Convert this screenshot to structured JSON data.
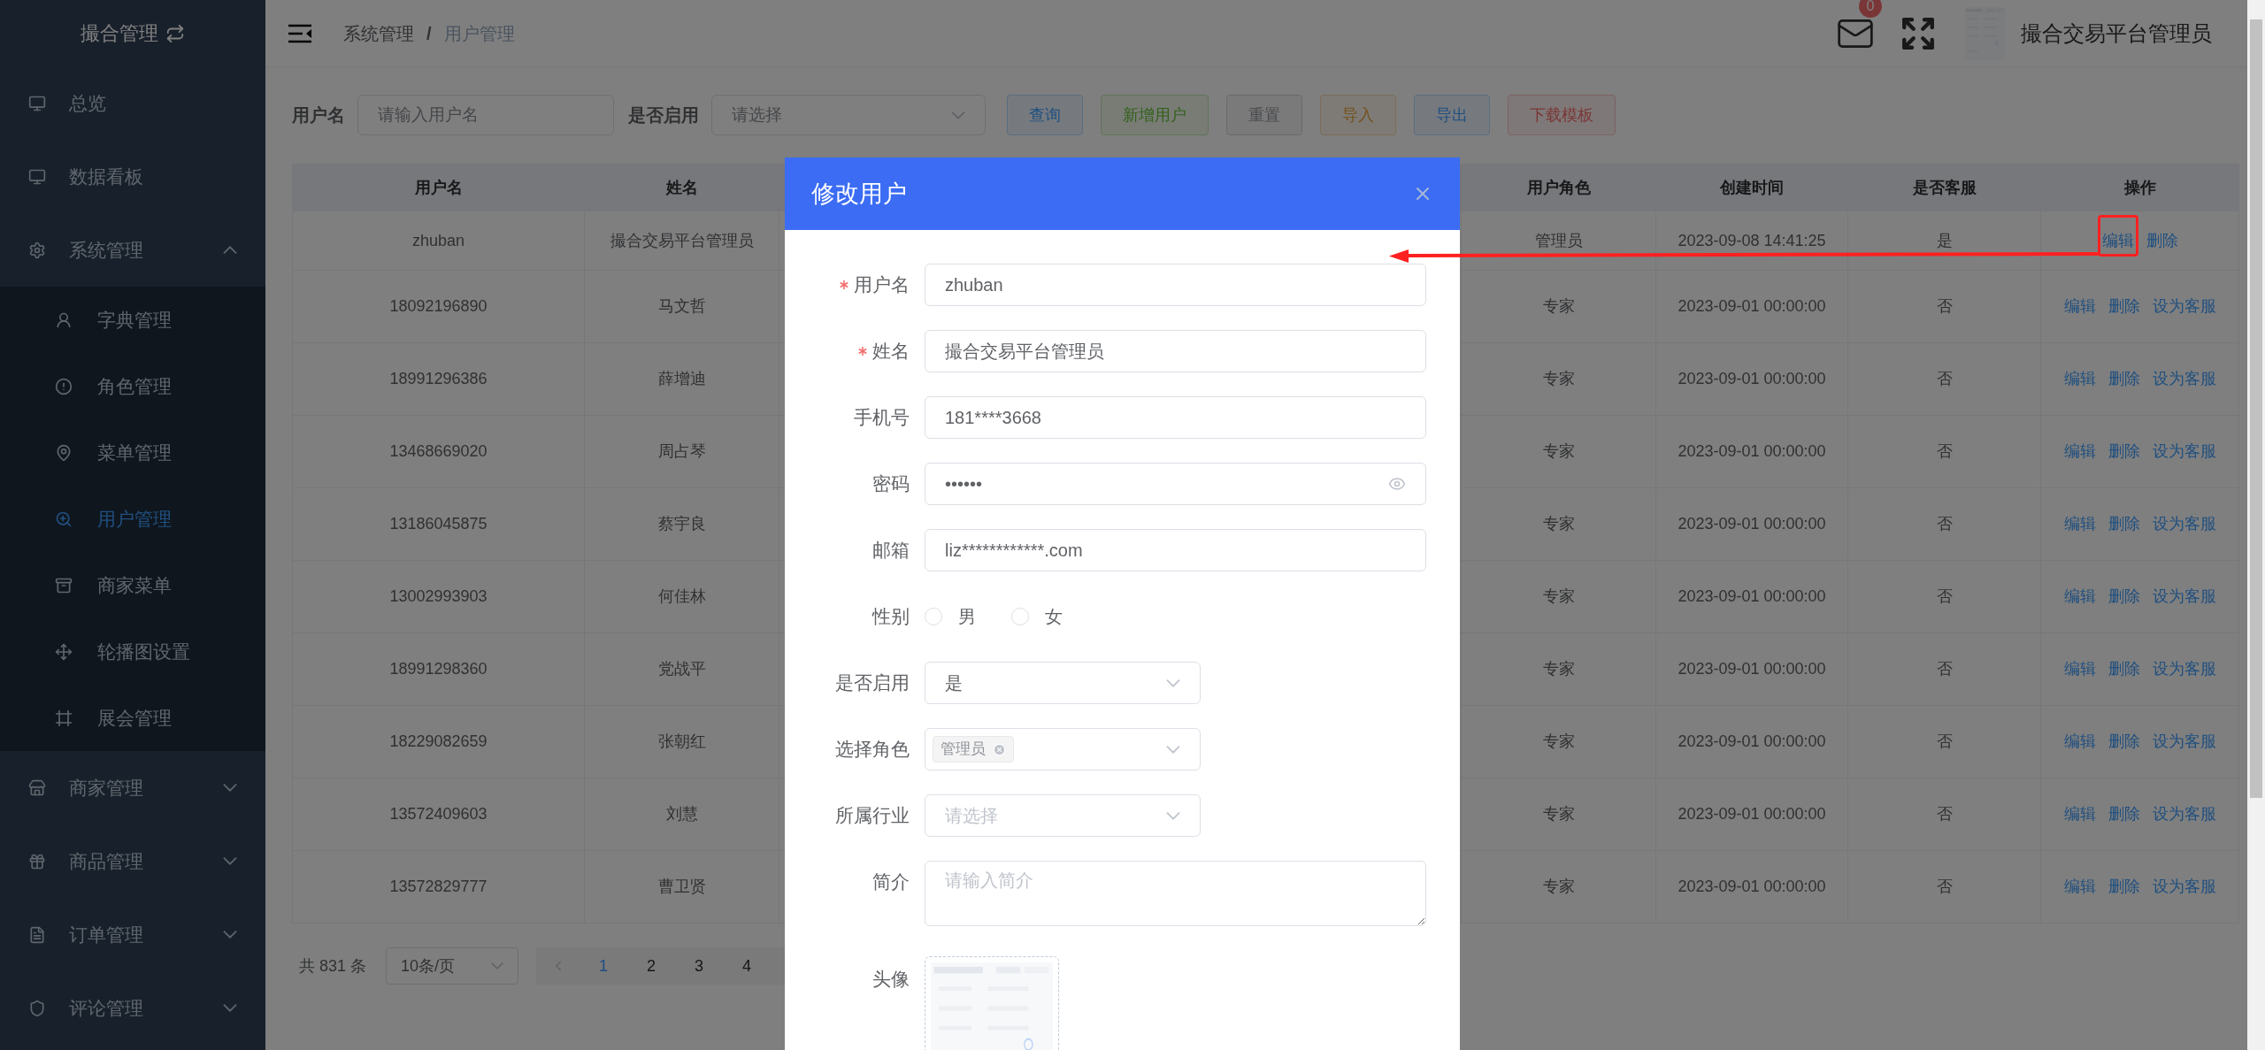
{
  "sidebar": {
    "title": "撮合管理",
    "items": [
      {
        "kind": "link",
        "label": "总览",
        "selected": false
      },
      {
        "kind": "link",
        "label": "数据看板",
        "selected": false
      },
      {
        "kind": "group",
        "label": "系统管理",
        "selected": false,
        "expanded": true,
        "children": [
          {
            "label": "字典管理",
            "selected": false
          },
          {
            "label": "角色管理",
            "selected": false
          },
          {
            "label": "菜单管理",
            "selected": false
          },
          {
            "label": "用户管理",
            "selected": true
          },
          {
            "label": "商家菜单",
            "selected": false
          },
          {
            "label": "轮播图设置",
            "selected": false
          },
          {
            "label": "展会管理",
            "selected": false
          }
        ]
      },
      {
        "kind": "group",
        "label": "商家管理",
        "selected": false,
        "expanded": false
      },
      {
        "kind": "group",
        "label": "商品管理",
        "selected": false,
        "expanded": false
      },
      {
        "kind": "group",
        "label": "订单管理",
        "selected": false,
        "expanded": false
      },
      {
        "kind": "group",
        "label": "评论管理",
        "selected": false,
        "expanded": false
      }
    ]
  },
  "header": {
    "breadcrumb": [
      "系统管理",
      "用户管理"
    ],
    "breadcrumb_separator": "/",
    "mail_badge": "0",
    "user_name": "撮合交易平台管理员"
  },
  "filters": [
    {
      "kind": "input",
      "label": "用户名",
      "placeholder": "请输入用户名"
    },
    {
      "kind": "select",
      "label": "是否启用",
      "placeholder": "请选择"
    }
  ],
  "toolbar_buttons": [
    {
      "label": "查询",
      "kind": "primary"
    },
    {
      "label": "新增用户",
      "kind": "success"
    },
    {
      "label": "重置",
      "kind": "info"
    },
    {
      "label": "导入",
      "kind": "warning"
    },
    {
      "label": "导出",
      "kind": "primary"
    },
    {
      "label": "下载模板",
      "kind": "danger"
    }
  ],
  "table": {
    "columns": [
      "用户名",
      "姓名",
      "用户角色",
      "创建时间",
      "是否客服",
      "操作"
    ],
    "rows": [
      {
        "username": "zhuban",
        "name": "撮合交易平台管理员",
        "role": "管理员",
        "created": "2023-09-08 14:41:25",
        "customer_service": "是",
        "actions": [
          "编辑",
          "删除"
        ]
      },
      {
        "username": "18092196890",
        "name": "马文哲",
        "role": "专家",
        "created": "2023-09-01 00:00:00",
        "customer_service": "否",
        "actions": [
          "编辑",
          "删除",
          "设为客服"
        ]
      },
      {
        "username": "18991296386",
        "name": "薛增迪",
        "role": "专家",
        "created": "2023-09-01 00:00:00",
        "customer_service": "否",
        "actions": [
          "编辑",
          "删除",
          "设为客服"
        ]
      },
      {
        "username": "13468669020",
        "name": "周占琴",
        "role": "专家",
        "created": "2023-09-01 00:00:00",
        "customer_service": "否",
        "actions": [
          "编辑",
          "删除",
          "设为客服"
        ]
      },
      {
        "username": "13186045875",
        "name": "蔡宇良",
        "role": "专家",
        "created": "2023-09-01 00:00:00",
        "customer_service": "否",
        "actions": [
          "编辑",
          "删除",
          "设为客服"
        ]
      },
      {
        "username": "13002993903",
        "name": "何佳林",
        "role": "专家",
        "created": "2023-09-01 00:00:00",
        "customer_service": "否",
        "actions": [
          "编辑",
          "删除",
          "设为客服"
        ]
      },
      {
        "username": "18991298360",
        "name": "党战平",
        "role": "专家",
        "created": "2023-09-01 00:00:00",
        "customer_service": "否",
        "actions": [
          "编辑",
          "删除",
          "设为客服"
        ]
      },
      {
        "username": "18229082659",
        "name": "张朝红",
        "role": "专家",
        "created": "2023-09-01 00:00:00",
        "customer_service": "否",
        "actions": [
          "编辑",
          "删除",
          "设为客服"
        ]
      },
      {
        "username": "13572409603",
        "name": "刘慧",
        "role": "专家",
        "created": "2023-09-01 00:00:00",
        "customer_service": "否",
        "actions": [
          "编辑",
          "删除",
          "设为客服"
        ]
      },
      {
        "username": "13572829777",
        "name": "曹卫贤",
        "role": "专家",
        "created": "2023-09-01 00:00:00",
        "customer_service": "否",
        "actions": [
          "编辑",
          "删除",
          "设为客服"
        ]
      }
    ]
  },
  "pagination": {
    "total": "共 831 条",
    "page_size": "10条/页",
    "pages": [
      {
        "label": "1",
        "selected": true
      },
      {
        "label": "2",
        "selected": false
      },
      {
        "label": "3",
        "selected": false
      },
      {
        "label": "4",
        "selected": false
      }
    ]
  },
  "modal": {
    "title": "修改用户",
    "fields": [
      {
        "kind": "text",
        "label": "用户名",
        "required": true,
        "value": "zhuban"
      },
      {
        "kind": "text",
        "label": "姓名",
        "required": true,
        "value": "撮合交易平台管理员"
      },
      {
        "kind": "text",
        "label": "手机号",
        "required": false,
        "value": "181****3668"
      },
      {
        "kind": "password",
        "label": "密码",
        "required": false,
        "value": "••••••"
      },
      {
        "kind": "text",
        "label": "邮箱",
        "required": false,
        "value": "liz************.com"
      },
      {
        "kind": "radio",
        "label": "性别",
        "required": false,
        "options": [
          {
            "label": "男",
            "selected": false
          },
          {
            "label": "女",
            "selected": false
          }
        ]
      },
      {
        "kind": "select",
        "label": "是否启用",
        "required": false,
        "value": "是"
      },
      {
        "kind": "tags",
        "label": "选择角色",
        "required": false,
        "tags": [
          "管理员"
        ]
      },
      {
        "kind": "select",
        "label": "所属行业",
        "required": false,
        "placeholder": "请选择"
      },
      {
        "kind": "textarea",
        "label": "简介",
        "required": false,
        "placeholder": "请输入简介"
      },
      {
        "label": "头像",
        "required": false
      }
    ]
  }
}
